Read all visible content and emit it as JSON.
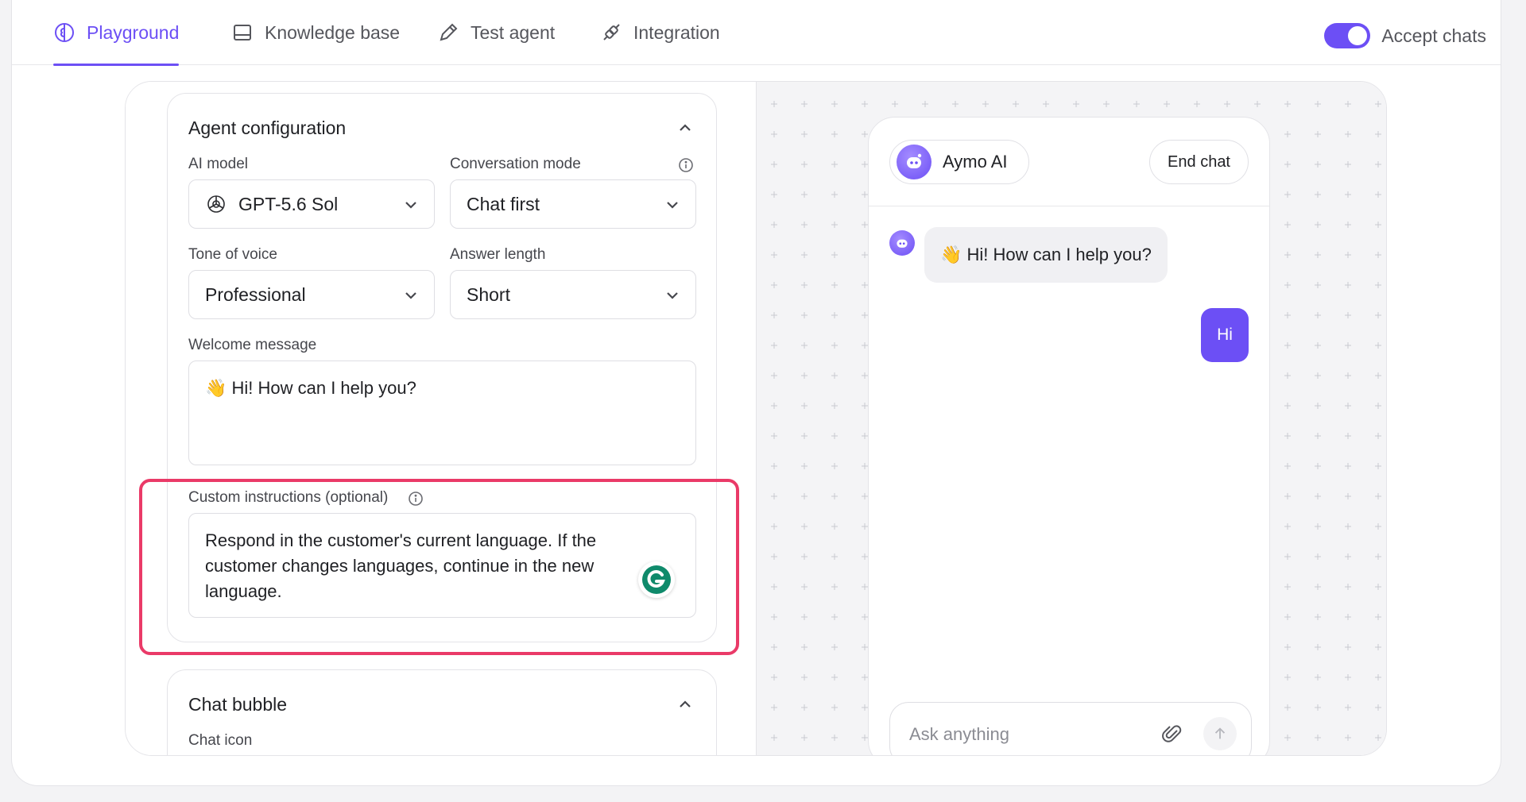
{
  "tabs": [
    {
      "label": "Playground",
      "icon": "brain-icon",
      "active": true
    },
    {
      "label": "Knowledge base",
      "icon": "book-icon",
      "active": false
    },
    {
      "label": "Test agent",
      "icon": "pencil-icon",
      "active": false
    },
    {
      "label": "Integration",
      "icon": "plug-icon",
      "active": false
    }
  ],
  "accept_chats": {
    "label": "Accept chats",
    "enabled": true
  },
  "agent_config": {
    "title": "Agent configuration",
    "ai_model": {
      "label": "AI model",
      "value": "GPT-5.6 Sol"
    },
    "conversation_mode": {
      "label": "Conversation mode",
      "value": "Chat first"
    },
    "tone_of_voice": {
      "label": "Tone of voice",
      "value": "Professional"
    },
    "answer_length": {
      "label": "Answer length",
      "value": "Short"
    },
    "welcome_message": {
      "label": "Welcome message",
      "value": "👋 Hi! How can I help you?"
    },
    "custom_instructions": {
      "label": "Custom instructions (optional)",
      "value": "Respond in the customer's current language. If the customer changes languages, continue in the new language."
    }
  },
  "chat_bubble": {
    "title": "Chat bubble",
    "chat_icon_label": "Chat icon"
  },
  "chat_preview": {
    "agent_name": "Aymo AI",
    "end_chat": "End chat",
    "messages": [
      {
        "from": "bot",
        "text": "👋 Hi! How can I help you?"
      },
      {
        "from": "user",
        "text": "Hi"
      }
    ],
    "composer_placeholder": "Ask anything"
  },
  "colors": {
    "accent": "#6c4ff5",
    "highlight": "#ea3a68"
  }
}
